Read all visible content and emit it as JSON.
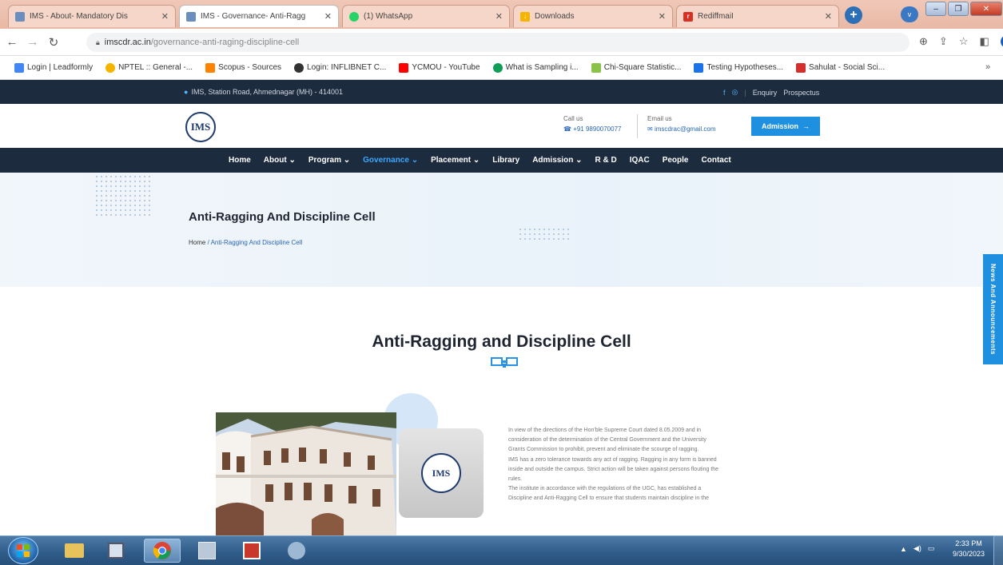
{
  "browser": {
    "tabs": [
      {
        "title": "IMS - About- Mandatory Dis",
        "icon": "ims-favicon",
        "color": "#6c8ebf"
      },
      {
        "title": "IMS - Governance- Anti-Ragg",
        "icon": "ims-favicon",
        "color": "#6c8ebf"
      },
      {
        "title": "(1) WhatsApp",
        "icon": "whatsapp-icon",
        "color": "#25d366"
      },
      {
        "title": "Downloads",
        "icon": "download-icon",
        "color": "#f4b400"
      },
      {
        "title": "RediffmaiI",
        "icon": "rediffmail-icon",
        "color": "#d93025"
      }
    ],
    "new_tab_label": "+",
    "profile_label": "v",
    "url_domain": "imscdr.ac.in",
    "url_path": "/governance-anti-raging-discipline-cell",
    "bookmarks": [
      {
        "label": "Login | Leadformly",
        "color": "#4285f4"
      },
      {
        "label": "NPTEL :: General -...",
        "color": "#f4b400"
      },
      {
        "label": "Scopus - Sources",
        "color": "#ff8200"
      },
      {
        "label": "Login: INFLIBNET C...",
        "color": "#333333"
      },
      {
        "label": "YCMOU - YouTube",
        "color": "#ff0000"
      },
      {
        "label": "What is Sampling i...",
        "color": "#0f9d58"
      },
      {
        "label": "Chi-Square Statistic...",
        "color": "#8bc34a"
      },
      {
        "label": "Testing Hypotheses...",
        "color": "#1a73e8"
      },
      {
        "label": "Sahulat - Social Sci...",
        "color": "#d32f2f"
      }
    ],
    "bookmarks_more": "»"
  },
  "site": {
    "topbar": {
      "address": "IMS, Station Road, Ahmednagar (MH) - 414001",
      "enquiry": "Enquiry",
      "prospectus": "Prospectus"
    },
    "logo_text": "IMS",
    "call": {
      "label": "Call us",
      "value": "+91 9890070077"
    },
    "email": {
      "label": "Email us",
      "value": "imscdrac@gmail.com"
    },
    "admission_button": "Admission",
    "nav": [
      "Home",
      "About ⌄",
      "Program ⌄",
      "Governance ⌄",
      "Placement ⌄",
      "Library",
      "Admission ⌄",
      "R & D",
      "IQAC",
      "People",
      "Contact"
    ],
    "active_nav_index": 3,
    "hero": {
      "title": "Anti-Ragging And Discipline Cell",
      "crumb_home": "Home",
      "crumb_current": "Anti-Ragging And Discipline Cell"
    },
    "side_tab": "News And Announcements",
    "section_title": "Anti-Ragging and Discipline Cell",
    "body_lines": [
      "In view of the directions of the Hon'ble Supreme Court dated 8.05.2009 and in",
      "consideration of the determination of the Central Government and the University",
      "Grants Commission to prohibit, prevent and eliminate the scourge of ragging.",
      "IMS has a zero tolerance towards any act of ragging. Ragging in any form is banned",
      "inside and outside the campus. Strict action will be taken against persons flouting the",
      "rules.",
      "The institute in accordance with the regulations of the UGC, has established a",
      "Discipline and Anti-Ragging Cell to ensure that students maintain discipline in the"
    ]
  },
  "taskbar": {
    "apps": [
      "ie-icon",
      "explorer-icon",
      "media-icon",
      "chrome-icon",
      "app-icon",
      "pdf-icon",
      "paint-icon"
    ],
    "time": "2:33 PM",
    "date": "9/30/2023"
  }
}
